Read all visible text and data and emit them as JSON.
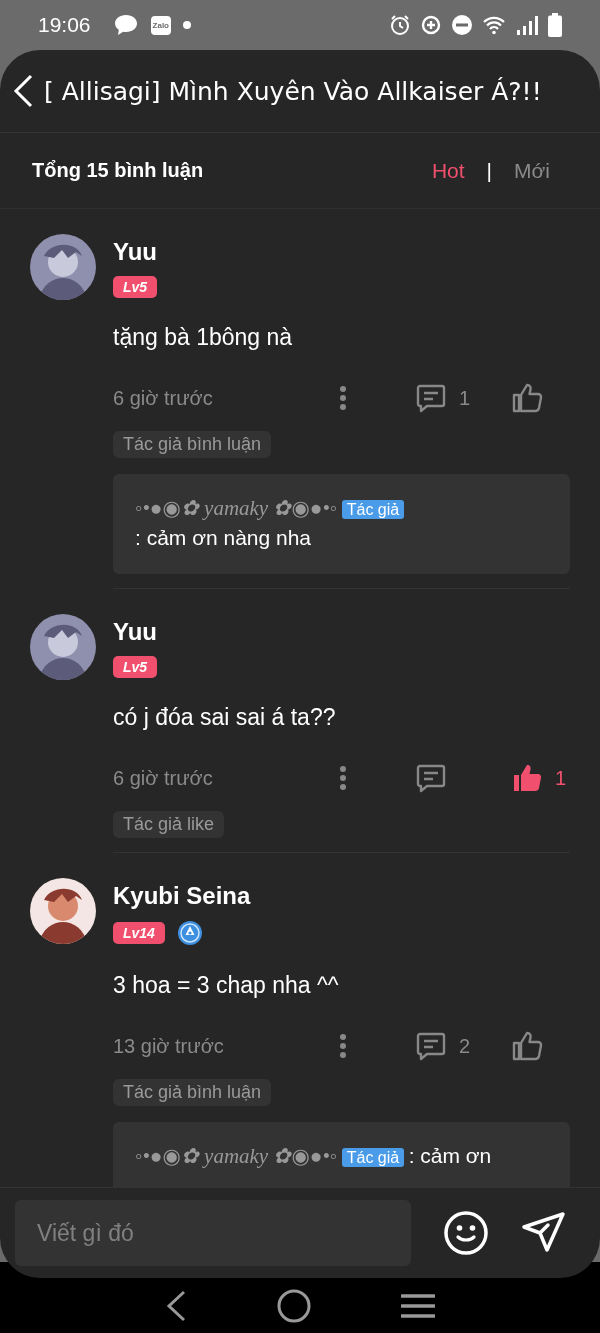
{
  "status_bar": {
    "time": "19:06",
    "app_badge": "Zalo"
  },
  "header": {
    "title": "[ Allisagi] Mình Xuyên Vào Allkaiser Á?!!"
  },
  "comment_bar": {
    "total": "Tổng 15 bình luận",
    "separator": "|",
    "sort_options": [
      {
        "label": "Hot",
        "selected": true
      },
      {
        "label": "Mới",
        "selected": false
      }
    ]
  },
  "comments": [
    {
      "name": "Yuu",
      "level": "Lv5",
      "verified": false,
      "avatar": {
        "kind": "picture"
      },
      "text": "tặng bà 1bông nà",
      "time": "6 giờ trước",
      "reply_count": "1",
      "liked": false,
      "tag": "Tác giả bình luận",
      "replies": [
        {
          "name": "◦•●◉✿ yamaky ✿◉●•◦",
          "badge": "Tác giả",
          "text": ": cảm ơn nàng nha"
        }
      ]
    },
    {
      "name": "Yuu",
      "level": "Lv5",
      "verified": false,
      "avatar": {
        "kind": "picture"
      },
      "text": "có j đóa sai sai á ta??",
      "time": "6 giờ trước",
      "liked": true,
      "like_count": "1",
      "tag": "Tác giả like"
    },
    {
      "name": "Kyubi Seina",
      "level": "Lv14",
      "verified": true,
      "avatar": {
        "kind": "picture"
      },
      "text": "3 hoa = 3 chap nha ^^",
      "time": "13 giờ trước",
      "reply_count": "2",
      "liked": false,
      "tag": "Tác giả bình luận",
      "replies": [
        {
          "name": "◦•●◉✿ yamaky ✿◉●•◦",
          "badge": "Tác giả",
          "text": ": cảm ơn"
        }
      ]
    }
  ],
  "composer": {
    "placeholder": "Viết gì đó"
  }
}
